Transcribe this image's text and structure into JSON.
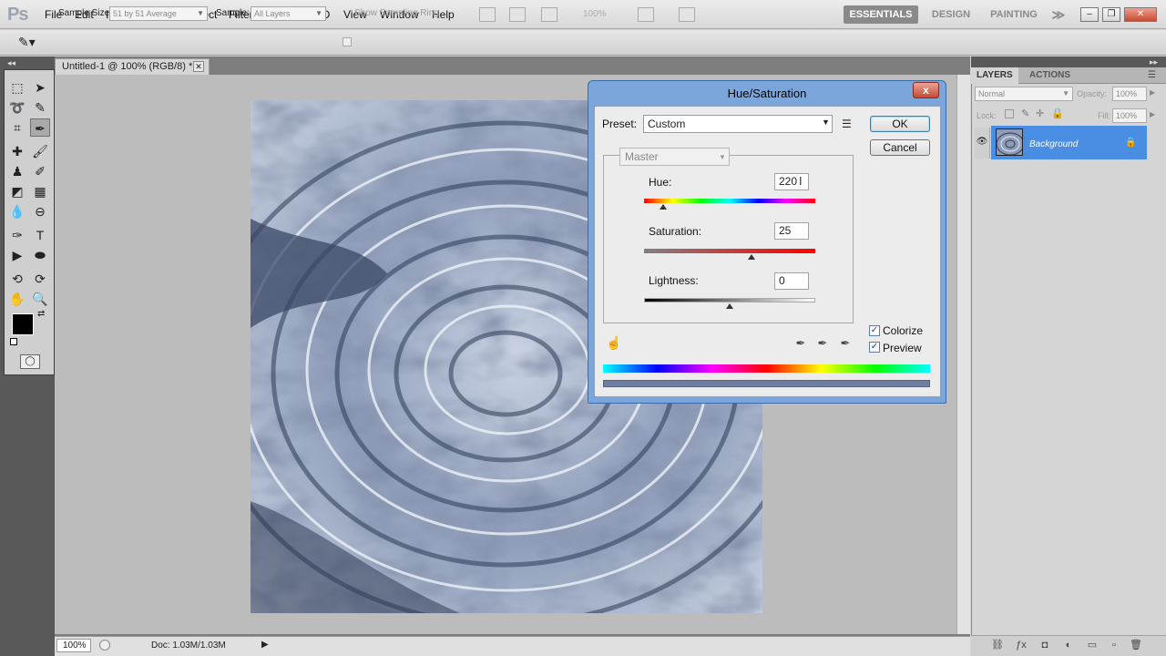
{
  "app": {
    "logo": "Ps",
    "menu": [
      "File",
      "Edit",
      "Image",
      "Layer",
      "Select",
      "Filter",
      "Analysis",
      "3D",
      "View",
      "Window",
      "Help"
    ],
    "zoom_display": "100%",
    "workspaces": [
      "ESSENTIALS",
      "DESIGN",
      "PAINTING"
    ],
    "workspace_more": "≫"
  },
  "options_bar": {
    "sample_size_label": "Sample Size:",
    "sample_size_value": "51 by 51 Average",
    "sample_label": "Sample:",
    "sample_value": "All Layers",
    "show_ring_label": "Show Sampling Ring"
  },
  "document": {
    "tab_title": "Untitled-1 @ 100% (RGB/8) *",
    "zoom": "100%",
    "doc_info": "Doc: 1.03M/1.03M"
  },
  "layers_panel": {
    "tabs": [
      "LAYERS",
      "ACTIONS"
    ],
    "blend_mode": "Normal",
    "opacity_label": "Opacity:",
    "opacity_value": "100%",
    "lock_label": "Lock:",
    "fill_label": "Fill:",
    "fill_value": "100%",
    "layers": [
      {
        "name": "Background"
      }
    ]
  },
  "dialog": {
    "title": "Hue/Saturation",
    "close_label": "x",
    "preset_label": "Preset:",
    "preset_value": "Custom",
    "channel": "Master",
    "hue_label": "Hue:",
    "hue_value": "220",
    "hue_level": 220,
    "hue_range": [
      -180,
      180
    ],
    "saturation_label": "Saturation:",
    "saturation_value": "25",
    "saturation_level": 25,
    "saturation_range": [
      -100,
      100
    ],
    "lightness_label": "Lightness:",
    "lightness_value": "0",
    "lightness_level": 0,
    "lightness_range": [
      -100,
      100
    ],
    "ok_label": "OK",
    "cancel_label": "Cancel",
    "colorize_label": "Colorize",
    "colorize_checked": true,
    "preview_label": "Preview",
    "preview_checked": true
  },
  "colors": {
    "accent_layer_selected": "#4a8ee3",
    "dialog_frame": "#7aa6dc",
    "foreground": "#000000",
    "background": "#ffffff",
    "colorize_tint": "#6f7e9e"
  }
}
